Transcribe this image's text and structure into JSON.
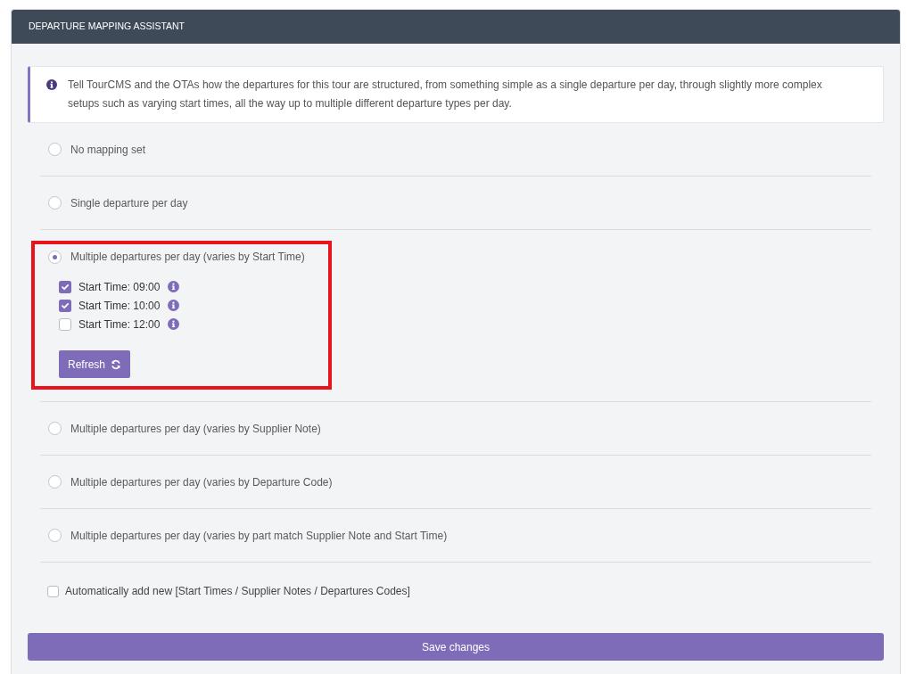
{
  "panel": {
    "title": "DEPARTURE MAPPING ASSISTANT"
  },
  "info": {
    "text": "Tell TourCMS and the OTAs how the departures for this tour are structured, from something simple as a single departure per day, through slightly more complex setups such as varying start times, all the way up to multiple different departure types per day."
  },
  "options": [
    {
      "label": "No mapping set",
      "selected": false,
      "highlighted": false
    },
    {
      "label": "Single departure per day",
      "selected": false,
      "highlighted": false
    },
    {
      "label": "Multiple departures per day (varies by Start Time)",
      "selected": true,
      "highlighted": true,
      "start_times": [
        {
          "label": "Start Time: 09:00",
          "checked": true
        },
        {
          "label": "Start Time: 10:00",
          "checked": true
        },
        {
          "label": "Start Time: 12:00",
          "checked": false
        }
      ],
      "refresh_button": "Refresh"
    },
    {
      "label": "Multiple departures per day (varies by Supplier Note)",
      "selected": false,
      "highlighted": false
    },
    {
      "label": "Multiple departures per day (varies by Departure Code)",
      "selected": false,
      "highlighted": false
    },
    {
      "label": "Multiple departures per day (varies by part match Supplier Note and Start Time)",
      "selected": false,
      "highlighted": false
    }
  ],
  "auto_add": {
    "label": "Automatically add new [Start Times / Supplier Notes / Departures Codes]",
    "checked": false
  },
  "save_button": "Save changes"
}
